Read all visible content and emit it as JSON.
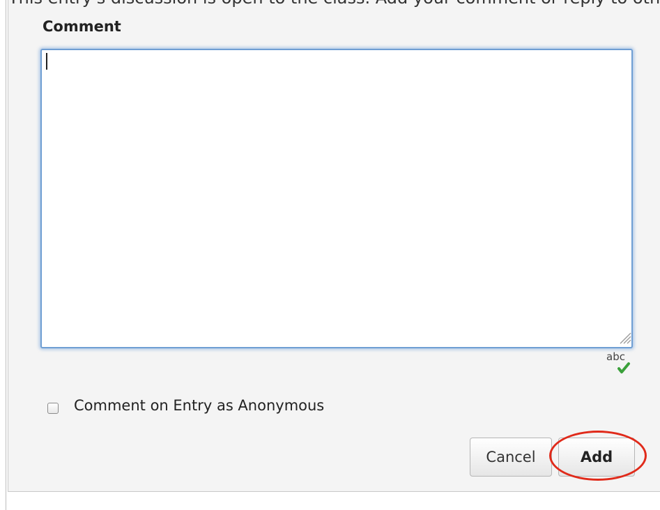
{
  "top_text": "This entry's discussion is open to the class. Add your comment or reply to others below.",
  "comment_form": {
    "label": "Comment",
    "textarea_value": "",
    "spellcheck_label": "abc",
    "anonymous_checkbox": {
      "label": "Comment on Entry as Anonymous",
      "checked": false
    },
    "cancel_label": "Cancel",
    "add_label": "Add"
  },
  "colors": {
    "focus_border": "#6f9ed3",
    "annotation": "#e02a1a",
    "spell_check": "#3aa03a"
  },
  "icons": {
    "resize": "resize-grip-icon",
    "spellcheck": "spellcheck-icon"
  }
}
